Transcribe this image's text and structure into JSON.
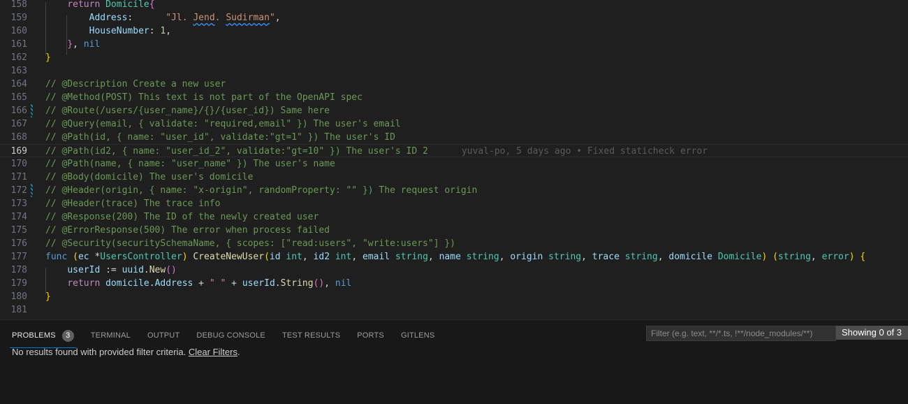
{
  "editor": {
    "lines": [
      {
        "n": "158",
        "tokens": [
          [
            "    ",
            ""
          ],
          [
            "return",
            "c-kw"
          ],
          [
            " ",
            ""
          ],
          [
            "Domicile",
            "c-type"
          ],
          [
            "{",
            "c-b2"
          ]
        ]
      },
      {
        "n": "159",
        "tokens": [
          [
            "        ",
            ""
          ],
          [
            "Address",
            "c-var"
          ],
          [
            ":      ",
            ""
          ],
          [
            "\"Jl. ",
            "c-str"
          ],
          [
            "Jend",
            "c-str squig"
          ],
          [
            ". ",
            "c-str"
          ],
          [
            "Sudirman",
            "c-str squig"
          ],
          [
            "\"",
            "c-str"
          ],
          [
            ",",
            ""
          ]
        ]
      },
      {
        "n": "160",
        "tokens": [
          [
            "        ",
            ""
          ],
          [
            "HouseNumber",
            "c-var"
          ],
          [
            ": ",
            ""
          ],
          [
            "1",
            "c-num"
          ],
          [
            ",",
            ""
          ]
        ]
      },
      {
        "n": "161",
        "tokens": [
          [
            "    ",
            ""
          ],
          [
            "}",
            "c-b2"
          ],
          [
            ", ",
            ""
          ],
          [
            "nil",
            "c-fn"
          ]
        ]
      },
      {
        "n": "162",
        "tokens": [
          [
            "}",
            "c-b1"
          ]
        ]
      },
      {
        "n": "163",
        "tokens": []
      },
      {
        "n": "164",
        "tokens": [
          [
            "// @Description Create a new user",
            "c-cmt"
          ]
        ]
      },
      {
        "n": "165",
        "tokens": [
          [
            "// @Method(POST) This text is not part of the OpenAPI spec",
            "c-cmt"
          ]
        ]
      },
      {
        "n": "166",
        "modified": true,
        "tokens": [
          [
            "// @Route(/users/{user_name}/{}/{user_id}) Same here",
            "c-cmt"
          ]
        ]
      },
      {
        "n": "167",
        "tokens": [
          [
            "// @Query(email, { validate: \"required,email\" }) The user's email",
            "c-cmt"
          ]
        ]
      },
      {
        "n": "168",
        "tokens": [
          [
            "// @Path(id, { name: \"user_id\", validate:\"gt=1\" }) The user's ID",
            "c-cmt"
          ]
        ]
      },
      {
        "n": "169",
        "current": true,
        "blame": "yuval-po, 5 days ago • Fixed staticheck error",
        "tokens": [
          [
            "// @Path(id2, { name: \"user_id_2\", validate:\"gt=10\" }) The user's ID 2",
            "c-cmt"
          ]
        ]
      },
      {
        "n": "170",
        "tokens": [
          [
            "// @Path(name, { name: \"user_name\" }) The user's name",
            "c-cmt"
          ]
        ]
      },
      {
        "n": "171",
        "tokens": [
          [
            "// @Body(domicile) The user's domicile",
            "c-cmt"
          ]
        ]
      },
      {
        "n": "172",
        "modified": true,
        "tokens": [
          [
            "// @Header(origin, { name: \"x-origin\", randomProperty: \"\" }) The request origin",
            "c-cmt"
          ]
        ]
      },
      {
        "n": "173",
        "tokens": [
          [
            "// @Header(trace) The trace info",
            "c-cmt"
          ]
        ]
      },
      {
        "n": "174",
        "tokens": [
          [
            "// @Response(200) The ID of the newly created user",
            "c-cmt"
          ]
        ]
      },
      {
        "n": "175",
        "tokens": [
          [
            "// @ErrorResponse(500) The error when process failed",
            "c-cmt"
          ]
        ]
      },
      {
        "n": "176",
        "tokens": [
          [
            "// @Security(securitySchemaName, { scopes: [\"read:users\", \"write:users\"] })",
            "c-cmt"
          ]
        ]
      },
      {
        "n": "177",
        "tokens": [
          [
            "func",
            "c-fn"
          ],
          [
            " ",
            ""
          ],
          [
            "(",
            "c-b1"
          ],
          [
            "ec",
            "c-var"
          ],
          [
            " *",
            ""
          ],
          [
            "UsersController",
            "c-type"
          ],
          [
            ")",
            "c-b1"
          ],
          [
            " ",
            ""
          ],
          [
            "CreateNewUser",
            "c-call"
          ],
          [
            "(",
            "c-b1"
          ],
          [
            "id",
            "c-var"
          ],
          [
            " ",
            ""
          ],
          [
            "int",
            "c-type"
          ],
          [
            ", ",
            ""
          ],
          [
            "id2",
            "c-var"
          ],
          [
            " ",
            ""
          ],
          [
            "int",
            "c-type"
          ],
          [
            ", ",
            ""
          ],
          [
            "email",
            "c-var"
          ],
          [
            " ",
            ""
          ],
          [
            "string",
            "c-type"
          ],
          [
            ", ",
            ""
          ],
          [
            "name",
            "c-var"
          ],
          [
            " ",
            ""
          ],
          [
            "string",
            "c-type"
          ],
          [
            ", ",
            ""
          ],
          [
            "origin",
            "c-var"
          ],
          [
            " ",
            ""
          ],
          [
            "string",
            "c-type"
          ],
          [
            ", ",
            ""
          ],
          [
            "trace",
            "c-var"
          ],
          [
            " ",
            ""
          ],
          [
            "string",
            "c-type"
          ],
          [
            ", ",
            ""
          ],
          [
            "domicile",
            "c-var"
          ],
          [
            " ",
            ""
          ],
          [
            "Domicile",
            "c-type"
          ],
          [
            ")",
            "c-b1"
          ],
          [
            " ",
            ""
          ],
          [
            "(",
            "c-b1"
          ],
          [
            "string",
            "c-type"
          ],
          [
            ", ",
            ""
          ],
          [
            "error",
            "c-type"
          ],
          [
            ")",
            "c-b1"
          ],
          [
            " ",
            ""
          ],
          [
            "{",
            "c-b1"
          ]
        ]
      },
      {
        "n": "178",
        "tokens": [
          [
            "    ",
            ""
          ],
          [
            "userId",
            "c-var"
          ],
          [
            " := ",
            ""
          ],
          [
            "uuid",
            "c-var"
          ],
          [
            ".",
            ""
          ],
          [
            "New",
            "c-call"
          ],
          [
            "()",
            "c-b2"
          ]
        ]
      },
      {
        "n": "179",
        "tokens": [
          [
            "    ",
            ""
          ],
          [
            "return",
            "c-kw"
          ],
          [
            " ",
            ""
          ],
          [
            "domicile",
            "c-var"
          ],
          [
            ".",
            ""
          ],
          [
            "Address",
            "c-var"
          ],
          [
            " + ",
            ""
          ],
          [
            "\" \"",
            "c-str"
          ],
          [
            " + ",
            ""
          ],
          [
            "userId",
            "c-var"
          ],
          [
            ".",
            ""
          ],
          [
            "String",
            "c-call"
          ],
          [
            "()",
            "c-b2"
          ],
          [
            ", ",
            ""
          ],
          [
            "nil",
            "c-fn"
          ]
        ]
      },
      {
        "n": "180",
        "tokens": [
          [
            "}",
            "c-b1"
          ]
        ]
      },
      {
        "n": "181",
        "tokens": []
      }
    ]
  },
  "panel": {
    "tabs": [
      {
        "label": "PROBLEMS",
        "badge": "3",
        "active": true
      },
      {
        "label": "TERMINAL"
      },
      {
        "label": "OUTPUT"
      },
      {
        "label": "DEBUG CONSOLE"
      },
      {
        "label": "TEST RESULTS"
      },
      {
        "label": "PORTS"
      },
      {
        "label": "GITLENS"
      }
    ],
    "message": "No results found with provided filter criteria.",
    "clear_filters": "Clear Filters",
    "message_suffix": ".",
    "filter_placeholder": "Filter (e.g. text, **/*.ts, !**/node_modules/**)",
    "showing": "Showing 0 of 3"
  }
}
